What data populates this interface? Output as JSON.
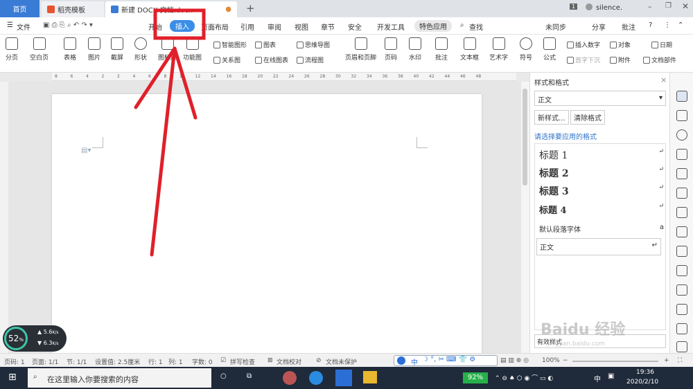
{
  "tabs": {
    "home": "首页",
    "t1": "稻壳模板",
    "t2": "新建 DOCX 文档.docx",
    "user": "silence.",
    "badge": "1"
  },
  "menu": {
    "file": "文件",
    "items": [
      "开始",
      "插入",
      "页面布局",
      "引用",
      "审阅",
      "视图",
      "章节",
      "安全",
      "开发工具"
    ],
    "special": "特色应用",
    "search": "查找",
    "sync": "未同步",
    "share": "分享",
    "comment": "批注"
  },
  "ribbon": {
    "big": [
      "分页",
      "空白页",
      "表格",
      "图片",
      "截屏",
      "形状",
      "图标库",
      "功能图",
      "页眉和页脚",
      "页码",
      "水印",
      "批注",
      "文本框",
      "艺术字",
      "符号",
      "公式"
    ],
    "small": [
      "智能图形",
      "图表",
      "思维导图",
      "关系图",
      "在线图表",
      "流程图",
      "插入数字",
      "对象",
      "日期",
      "首字下沉",
      "附件",
      "文档部件"
    ]
  },
  "ruler_ticks": [
    "8",
    "6",
    "4",
    "2",
    "2",
    "4",
    "6",
    "8",
    "10",
    "12",
    "14",
    "16",
    "18",
    "20",
    "22",
    "24",
    "26",
    "28",
    "30",
    "32",
    "34",
    "36",
    "38",
    "40",
    "42",
    "44",
    "46",
    "48"
  ],
  "panel": {
    "title": "样式和格式",
    "current": "正文",
    "new_style": "新样式...",
    "clear_style": "清除格式",
    "prompt": "请选择要应用的格式",
    "styles": [
      "标题 1",
      "标题 2",
      "标题 3",
      "标题 4"
    ],
    "default_font": "默认段落字体",
    "body": "正文",
    "show": "有效样式"
  },
  "status": {
    "page": "页码: 1",
    "pages": "页面: 1/1",
    "section": "节: 1/1",
    "setting": "设置值: 2.5厘米",
    "row": "行: 1",
    "col": "列: 1",
    "words": "字数: 0",
    "spell": "拼写检查",
    "proof": "文档校对",
    "protect": "文档未保护",
    "zoom": "100%"
  },
  "perf": {
    "percent": "52",
    "unit": "%",
    "up": "5.6",
    "down": "6.3",
    "rate": "K/s"
  },
  "ime": "中",
  "taskbar": {
    "search": "在这里输入你要搜索的内容",
    "battery": "92%",
    "lang": "中",
    "time": "19:36",
    "date": "2020/2/10"
  },
  "watermark": "Baidu 经验",
  "watermark_url": "jingyan.baidu.com",
  "colors": {
    "accent": "#3b8ee8",
    "arrow": "#e0202a"
  }
}
